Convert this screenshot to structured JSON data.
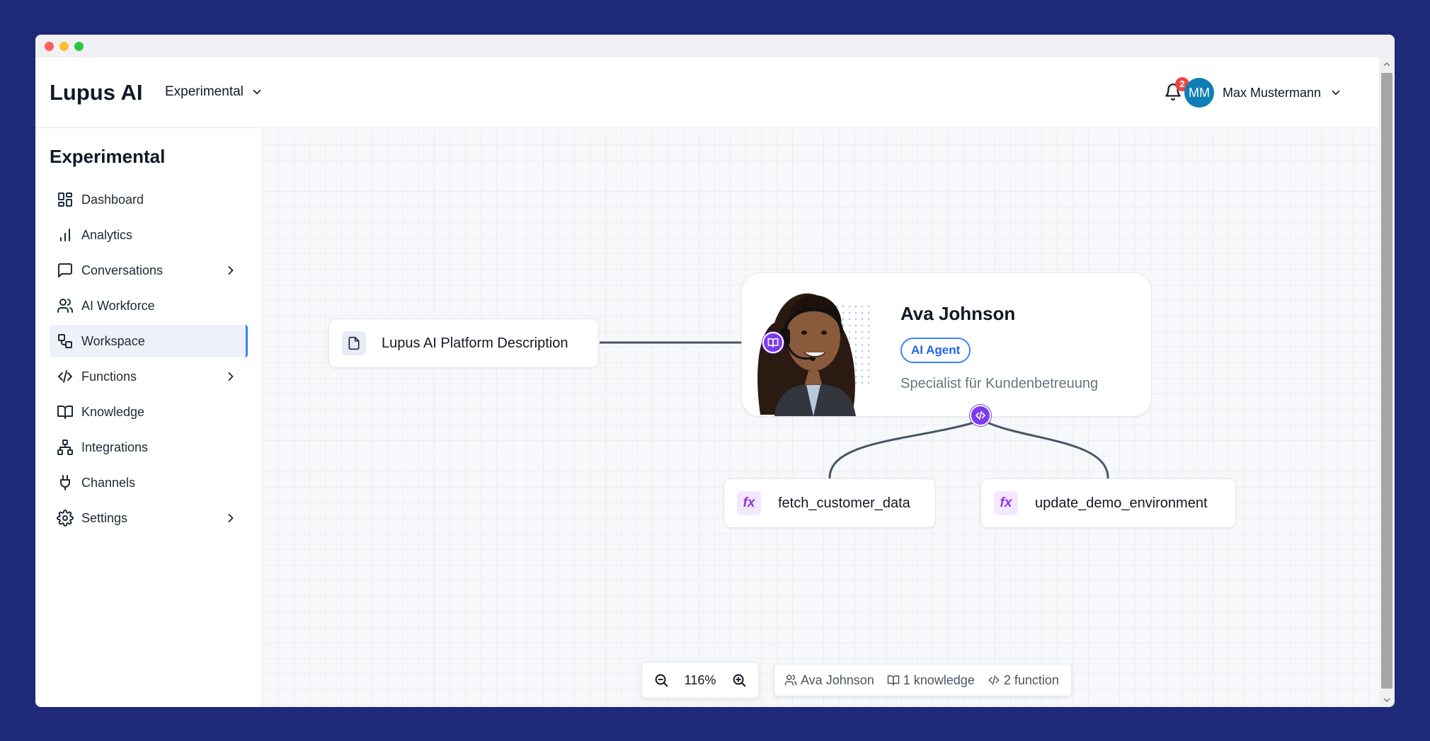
{
  "app": {
    "brand": "Lupus AI",
    "environment": "Experimental"
  },
  "header": {
    "notifications_count": "2",
    "user": {
      "initials": "MM",
      "name": "Max Mustermann"
    }
  },
  "sidebar": {
    "title": "Experimental",
    "items": [
      {
        "label": "Dashboard",
        "icon": "dashboard-icon"
      },
      {
        "label": "Analytics",
        "icon": "analytics-icon"
      },
      {
        "label": "Conversations",
        "icon": "chat-icon",
        "expandable": true
      },
      {
        "label": "AI Workforce",
        "icon": "users-icon"
      },
      {
        "label": "Workspace",
        "icon": "workspace-icon",
        "active": true
      },
      {
        "label": "Functions",
        "icon": "code-icon",
        "expandable": true
      },
      {
        "label": "Knowledge",
        "icon": "book-icon"
      },
      {
        "label": "Integrations",
        "icon": "network-icon"
      },
      {
        "label": "Channels",
        "icon": "plug-icon"
      },
      {
        "label": "Settings",
        "icon": "gear-icon",
        "expandable": true
      }
    ]
  },
  "canvas": {
    "knowledge_node": {
      "label": "Lupus AI Platform Description"
    },
    "agent": {
      "name": "Ava Johnson",
      "badge": "AI Agent",
      "role": "Specialist für Kundenbetreuung"
    },
    "functions": [
      {
        "label": "fetch_customer_data"
      },
      {
        "label": "update_demo_environment"
      }
    ],
    "fx_label": "fx"
  },
  "zoom": {
    "value": "116%"
  },
  "stats": {
    "agent": "Ava Johnson",
    "knowledge": "1 knowledge",
    "functions": "2 function"
  },
  "colors": {
    "accent": "#3b82f6",
    "handle": "#7c3aed",
    "background": "#1e2a78",
    "avatar": "#0e7fb6"
  }
}
